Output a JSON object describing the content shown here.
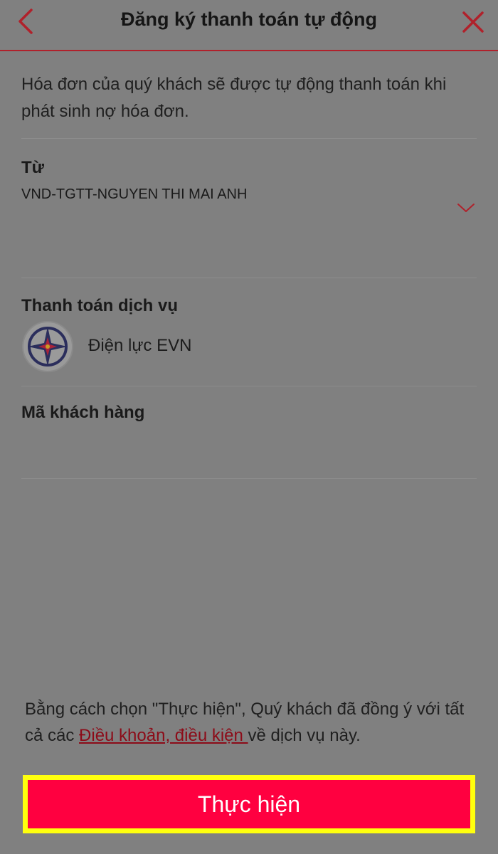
{
  "header": {
    "title": "Đăng ký thanh toán tự động",
    "back_icon": "chevron-left-icon",
    "close_icon": "close-icon"
  },
  "intro": "Hóa đơn của quý khách sẽ được tự động thanh toán khi phát sinh nợ hóa đơn.",
  "source": {
    "label": "Từ",
    "value": "VND-TGTT-NGUYEN THI MAI ANH",
    "icon": "chevron-down-icon"
  },
  "service": {
    "label": "Thanh toán dịch vụ",
    "name": "Điện lực EVN",
    "logo": "evn-logo-icon"
  },
  "customer": {
    "label": "Mã khách hàng",
    "value": ""
  },
  "terms": {
    "prefix": "Bằng cách chọn \"Thực hiện\", Quý khách đã đồng ý với tất cả các ",
    "link": "Điều khoản, điều kiện ",
    "suffix": "về dịch vụ này."
  },
  "submit": {
    "label": "Thực hiện"
  },
  "colors": {
    "accent": "#b0212b",
    "button": "#ff0040",
    "highlight": "#ffff0d",
    "link": "#8c0b18",
    "background": "#808080"
  }
}
